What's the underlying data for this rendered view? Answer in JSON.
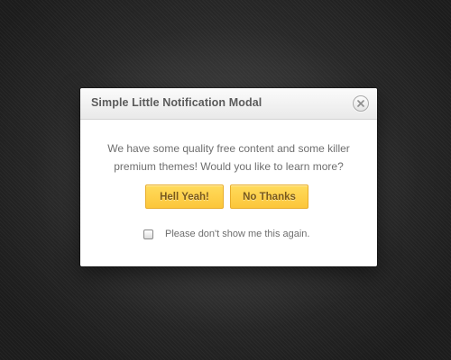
{
  "modal": {
    "title": "Simple Little Notification Modal",
    "message_line1": "We have some quality free content and some killer",
    "message_line2": "premium themes! Would you like to learn more?",
    "buttons": {
      "yes_label": "Hell Yeah!",
      "no_label": "No Thanks"
    },
    "dont_show_again": {
      "label": "Please don't show me this again.",
      "checked": false
    },
    "close_icon": "close-icon"
  },
  "colors": {
    "button_fill": "#fcc63a",
    "button_text": "#7a5a1a",
    "background": "#2a2a2a"
  }
}
